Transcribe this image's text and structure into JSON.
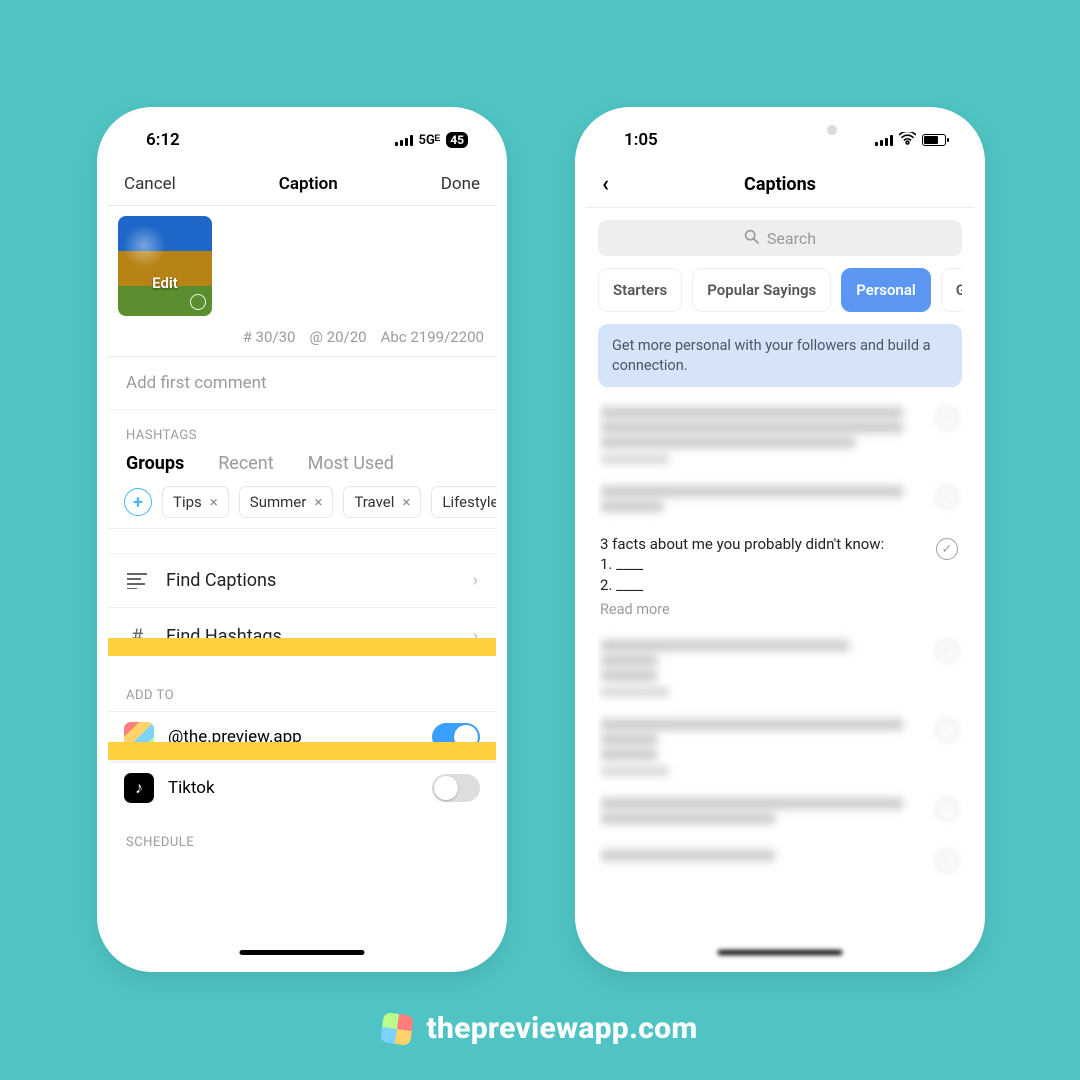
{
  "brand": {
    "url": "thepreviewapp.com"
  },
  "left": {
    "status": {
      "time": "6:12",
      "net": "5Gᴱ",
      "battery": "45"
    },
    "nav": {
      "cancel": "Cancel",
      "title": "Caption",
      "done": "Done"
    },
    "thumb": {
      "edit": "Edit"
    },
    "counters": {
      "hash": "# 30/30",
      "at": "@ 20/20",
      "abc": "Abc 2199/2200"
    },
    "first_comment_placeholder": "Add first comment",
    "hashtags_label": "HASHTAGS",
    "seg": {
      "groups": "Groups",
      "recent": "Recent",
      "most_used": "Most Used"
    },
    "chips": [
      "Tips",
      "Summer",
      "Travel",
      "Lifestyle"
    ],
    "rows": {
      "find_captions": "Find Captions",
      "find_hashtags": "Find Hashtags"
    },
    "addto_label": "ADD TO",
    "accounts": {
      "preview": "@the.preview.app",
      "tiktok": "Tiktok"
    },
    "schedule_label": "SCHEDULE"
  },
  "right": {
    "status": {
      "time": "1:05"
    },
    "nav": {
      "title": "Captions"
    },
    "search_placeholder": "Search",
    "tabs": [
      "Starters",
      "Popular Sayings",
      "Personal",
      "Get Comments"
    ],
    "active_tab_index": 2,
    "banner": "Get more personal with your followers and build a connection.",
    "visible_caption": {
      "line1": "3 facts about me you probably didn't know:",
      "line2": "1. ____",
      "line3": "2. ____",
      "read_more": "Read more"
    }
  }
}
